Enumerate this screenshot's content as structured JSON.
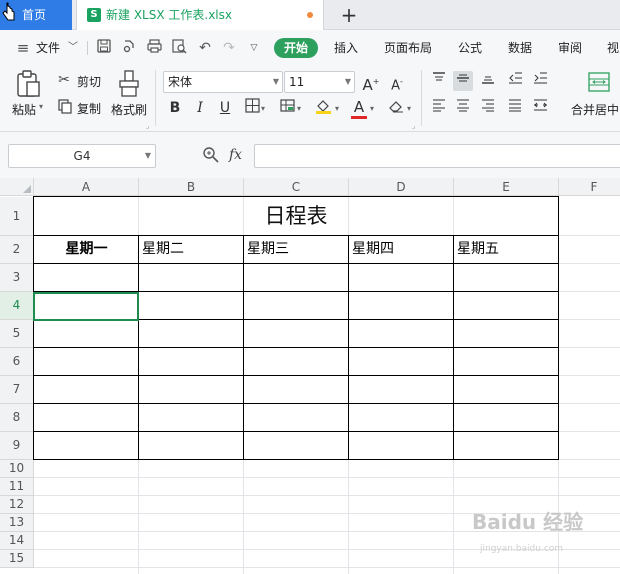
{
  "tabs": {
    "home_label": "首页",
    "doc_icon": "S",
    "doc_title": "新建 XLSX 工作表.xlsx",
    "add_icon": "+"
  },
  "menu": {
    "file_label": "文件",
    "items": [
      "开始",
      "插入",
      "页面布局",
      "公式",
      "数据",
      "审阅",
      "视"
    ]
  },
  "ribbon": {
    "paste_label": "粘贴",
    "cut_label": "剪切",
    "copy_label": "复制",
    "format_painter_label": "格式刷",
    "font_name": "宋体",
    "font_size": "11",
    "merge_label": "合并居中"
  },
  "formula_bar": {
    "name_box": "G4",
    "fx_label": "fx",
    "formula_value": ""
  },
  "sheet": {
    "columns": [
      "A",
      "B",
      "C",
      "D",
      "E",
      "F"
    ],
    "rows": [
      "1",
      "2",
      "3",
      "4",
      "5",
      "6",
      "7",
      "8",
      "9",
      "10",
      "11",
      "12",
      "13",
      "14",
      "15"
    ],
    "title": "日程表",
    "headers": [
      "星期一",
      "星期二",
      "星期三",
      "星期四",
      "星期五"
    ],
    "selected_row": "4"
  },
  "watermark": {
    "text": "Baidu 经验",
    "url": "jingyan.baidu.com"
  }
}
